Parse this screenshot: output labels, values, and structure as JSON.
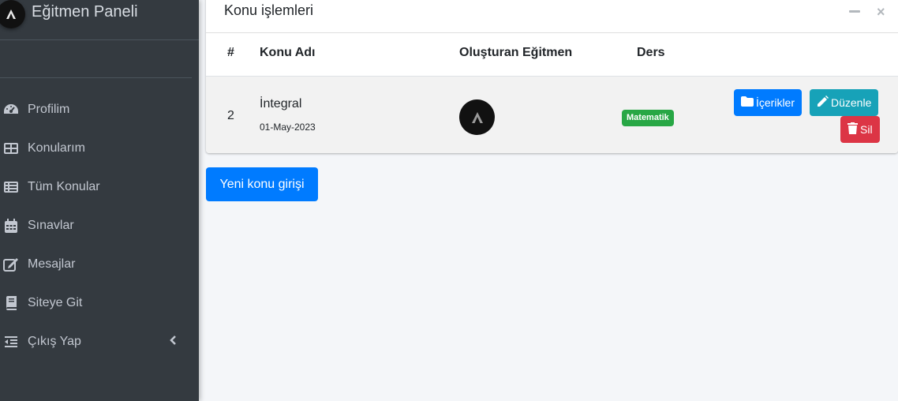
{
  "sidebar": {
    "brand_title": "Eğitmen Paneli",
    "items": [
      {
        "label": "Profilim",
        "icon": "tachometer-icon"
      },
      {
        "label": "Konularım",
        "icon": "table-icon"
      },
      {
        "label": "Tüm Konular",
        "icon": "list-icon"
      },
      {
        "label": "Sınavlar",
        "icon": "calendar-icon"
      },
      {
        "label": "Mesajlar",
        "icon": "edit-icon"
      },
      {
        "label": "Siteye Git",
        "icon": "book-icon"
      },
      {
        "label": "Çıkış Yap",
        "icon": "outdent-icon",
        "chevron": "chevron-left-icon"
      }
    ]
  },
  "card": {
    "title": "Konu işlemleri",
    "columns": [
      "#",
      "Konu Adı",
      "Oluşturan Eğitmen",
      "Ders"
    ],
    "rows": [
      {
        "num": "2",
        "title": "İntegral",
        "date": "01-May-2023",
        "course": "Matematik",
        "actions": {
          "contents": "İçerikler",
          "edit": "Düzenle",
          "delete": "Sil"
        }
      }
    ]
  },
  "new_topic_button": "Yeni konu girişi",
  "colors": {
    "sidebar_bg": "#343a40",
    "primary": "#007bff",
    "info": "#17a2b8",
    "danger": "#dc3545",
    "success": "#28a745",
    "content_bg": "#f4f6f9"
  }
}
